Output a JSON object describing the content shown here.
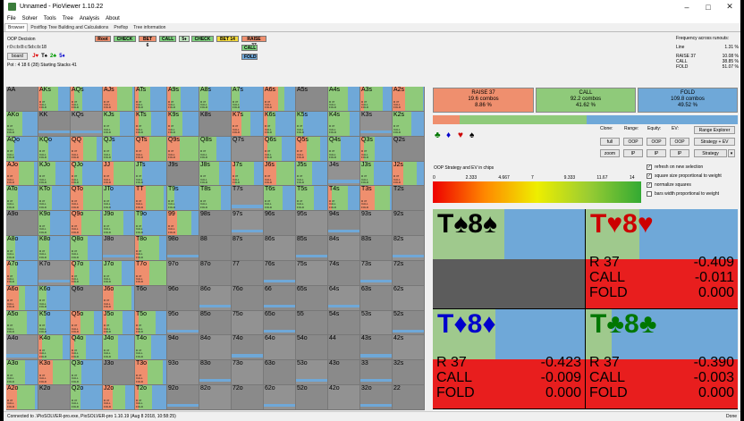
{
  "window": {
    "title": "Unnamed - PioViewer 1.10.22"
  },
  "menu": [
    "File",
    "Solver",
    "Tools",
    "Tree",
    "Analysis",
    "About"
  ],
  "tabs": [
    "Browser",
    "Postflop Tree Building and Calculations",
    "Preflop",
    "Tree information"
  ],
  "decision": {
    "title": "OOP Decision",
    "line": "r:0:c:b:8:c:5d:c:b:18",
    "board_label": "board",
    "board_cards": [
      {
        "t": "J♥",
        "c": "#d00"
      },
      {
        "t": "T♠",
        "c": "#000"
      },
      {
        "t": "2♣",
        "c": "#090"
      },
      {
        "t": "5♦",
        "c": "#00c"
      }
    ],
    "pot": "Pot : 4 18 6 (28) Starting Stacks 41"
  },
  "nav": [
    "Root",
    "CHECK",
    "BET 6",
    "CALL",
    "5♦",
    "CHECK",
    "BET 14",
    "RAISE 37",
    "CALL",
    "FOLD"
  ],
  "freq": {
    "title": "Frequency across runouts:",
    "rows": [
      [
        "Line",
        "1.31 %"
      ],
      [
        "RAISE 37",
        "10.08 %"
      ],
      [
        "CALL",
        "38.85 %"
      ],
      [
        "FOLD",
        "51.07 %"
      ]
    ]
  },
  "colors": {
    "raise": "#ef8f6e",
    "call": "#8fca7a",
    "fold": "#6fa8d8",
    "check": "#7ed27e",
    "bet": "#f2d83a"
  },
  "summary": [
    {
      "label": "RAISE 37",
      "combos": "19.6 combos",
      "pct": "8.86 %"
    },
    {
      "label": "CALL",
      "combos": "92.2 combos",
      "pct": "41.62 %"
    },
    {
      "label": "FOLD",
      "combos": "109.8 combos",
      "pct": "49.52 %"
    }
  ],
  "controls": {
    "clone": "Clone:",
    "range": "Range:",
    "equity": "Equity:",
    "ev": "EV:",
    "btns": [
      "full",
      "OOP",
      "OOP",
      "OOP",
      "zoom",
      "IP",
      "IP",
      "IP"
    ],
    "range_explorer": "Range Explorer",
    "strategy_ev": "Strategy + EV",
    "strategy": "Strategy",
    "chart_label": "OOP Strategy and EV in chips",
    "checks": [
      "refresh on new selection",
      "square size proportional to weight",
      "normalize squares",
      "bars width proportional to weight"
    ],
    "scale": [
      "0",
      "2.333",
      "4.667",
      "7",
      "9.333",
      "11.67",
      "14"
    ]
  },
  "combos": [
    {
      "name": "T♠8♠",
      "color": "#000",
      "bars": [
        0.0,
        0.47,
        0.53
      ],
      "rows": []
    },
    {
      "name": "T♥8♥",
      "color": "#c00",
      "bars": [
        0.0,
        0.35,
        0.65
      ],
      "rows": [
        [
          "R 37",
          "-0.409"
        ],
        [
          "CALL",
          "-0.011"
        ],
        [
          "FOLD",
          "0.000"
        ]
      ]
    },
    {
      "name": "T♦8♦",
      "color": "#00c",
      "bars": [
        0.0,
        0.41,
        0.59
      ],
      "rows": [
        [
          "R 37",
          "-0.423"
        ],
        [
          "CALL",
          "-0.009"
        ],
        [
          "FOLD",
          "0.000"
        ]
      ]
    },
    {
      "name": "T♣8♣",
      "color": "#070",
      "bars": [
        0.0,
        0.17,
        0.83
      ],
      "rows": [
        [
          "R 37",
          "-0.390"
        ],
        [
          "CALL",
          "-0.003"
        ],
        [
          "FOLD",
          "0.000"
        ]
      ]
    }
  ],
  "status": {
    "left": "Connected to .\\PioSOLVER-pro.exe, PioSOLVER-pro 1.10.19 (Aug  8 2018, 10:58:25)",
    "right": "Done"
  }
}
